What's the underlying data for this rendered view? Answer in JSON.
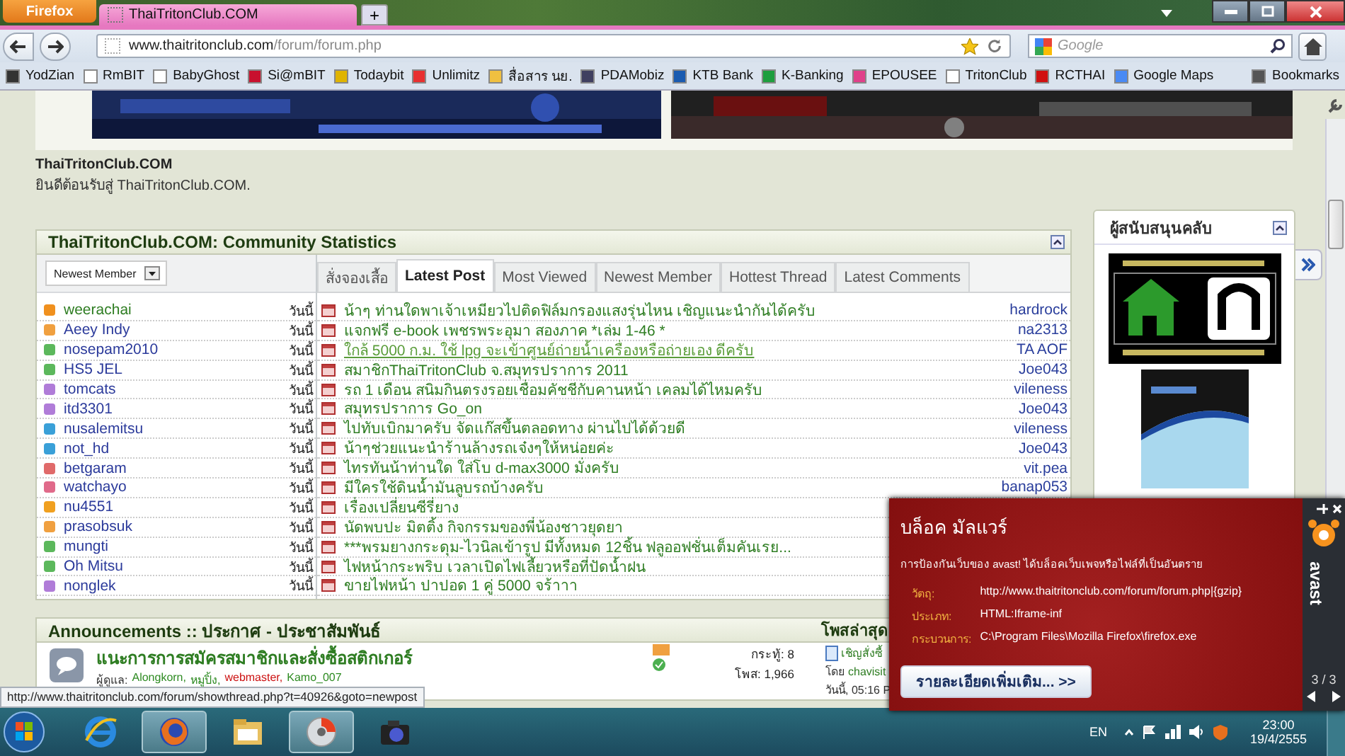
{
  "browser": {
    "app_button": "Firefox",
    "tabs": [
      {
        "title": "ThaiTritonClub.COM",
        "selected": true
      }
    ],
    "new_tab": "+",
    "url_host": "www.thaitritonclub.com",
    "url_path": "/forum/forum.php",
    "search_placeholder": "Google"
  },
  "bookmarks": [
    {
      "label": "YodZian",
      "color": "#333333"
    },
    {
      "label": "RmBIT",
      "color": "#ffffff"
    },
    {
      "label": "BabyGhost",
      "color": "#ffffff"
    },
    {
      "label": "Si@mBIT",
      "color": "#c8102e"
    },
    {
      "label": "Todaybit",
      "color": "#e0b400"
    },
    {
      "label": "Unlimitz",
      "color": "#e83030"
    },
    {
      "label": "สื่อสาร นย.",
      "color": "#f0c040"
    },
    {
      "label": "PDAMobiz",
      "color": "#404060"
    },
    {
      "label": "KTB Bank",
      "color": "#1a5bb0"
    },
    {
      "label": "K-Banking",
      "color": "#1e9e3e"
    },
    {
      "label": "EPOUSEE",
      "color": "#e0408a"
    },
    {
      "label": "TritonClub",
      "color": "#ffffff"
    },
    {
      "label": "RCTHAI",
      "color": "#d01010"
    },
    {
      "label": "Google Maps",
      "color": "#4a8af4"
    }
  ],
  "bookmarks_menu": "Bookmarks",
  "site": {
    "title": "ThaiTritonClub.COM",
    "welcome": "ยินดีต้อนรับสู่ ThaiTritonClub.COM."
  },
  "stats": {
    "title": "ThaiTritonClub.COM: Community Statistics",
    "dropdown": "Newest Member",
    "members": [
      {
        "name": "weerachai",
        "date": "วันนี้",
        "color": "#f0901e",
        "visited": true
      },
      {
        "name": "Aeey Indy",
        "date": "วันนี้",
        "color": "#f0a040",
        "visited": false
      },
      {
        "name": "nosepam2010",
        "date": "วันนี้",
        "color": "#5cb85c",
        "visited": false
      },
      {
        "name": "HS5 JEL",
        "date": "วันนี้",
        "color": "#5cb85c",
        "visited": false
      },
      {
        "name": "tomcats",
        "date": "วันนี้",
        "color": "#b07cd8",
        "visited": false
      },
      {
        "name": "itd3301",
        "date": "วันนี้",
        "color": "#b07cd8",
        "visited": false
      },
      {
        "name": "nusalemitsu",
        "date": "วันนี้",
        "color": "#3aa0d8",
        "visited": false
      },
      {
        "name": "not_hd",
        "date": "วันนี้",
        "color": "#3aa0d8",
        "visited": false
      },
      {
        "name": "betgaram",
        "date": "วันนี้",
        "color": "#e06a6a",
        "visited": false
      },
      {
        "name": "watchayo",
        "date": "วันนี้",
        "color": "#e06a8a",
        "visited": false
      },
      {
        "name": "nu4551",
        "date": "วันนี้",
        "color": "#f0a020",
        "visited": false
      },
      {
        "name": "prasobsuk",
        "date": "วันนี้",
        "color": "#f0a040",
        "visited": false
      },
      {
        "name": "mungti",
        "date": "วันนี้",
        "color": "#5cb85c",
        "visited": false
      },
      {
        "name": "Oh Mitsu",
        "date": "วันนี้",
        "color": "#5cb85c",
        "visited": false
      },
      {
        "name": "nonglek",
        "date": "วันนี้",
        "color": "#b07cd8",
        "visited": false
      }
    ],
    "tabs": [
      {
        "label": "สั่งจองเสื้อ",
        "selected": false
      },
      {
        "label": "Latest Post",
        "selected": true
      },
      {
        "label": "Most Viewed",
        "selected": false
      },
      {
        "label": "Newest Member",
        "selected": false
      },
      {
        "label": "Hottest Thread",
        "selected": false
      },
      {
        "label": "Latest Comments",
        "selected": false
      }
    ],
    "posts": [
      {
        "title": "น้าๆ ท่านใดพาเจ้าเหมียวไปติดฟิล์มกรองแสงรุ่นไหน เชิญแนะนำกันได้ครับ",
        "author": "hardrock",
        "hovered": false
      },
      {
        "title": "แจกฟรี e-book เพชรพระอุมา สองภาค *เล่ม 1-46 *",
        "author": "na2313",
        "hovered": false
      },
      {
        "title": "ใกล้ 5000 ก.ม. ใช้ lpg จะเข้าศูนย์ถ่ายน้ำเครื่องหรือถ่ายเอง ดีครับ",
        "author": "TA AOF",
        "hovered": true
      },
      {
        "title": "สมาชิกThaiTritonClub จ.สมุทรปราการ 2011",
        "author": "Joe043",
        "hovered": false
      },
      {
        "title": "รถ 1 เดือน สนิมกินตรงรอยเชื่อมคัชชีกับคานหน้า เคลมได้ไหมครับ",
        "author": "vileness",
        "hovered": false
      },
      {
        "title": "สมุทรปราการ Go_on",
        "author": "Joe043",
        "hovered": false
      },
      {
        "title": "ไปทับเบิกมาครับ จัดแก๊สขึ้นตลอดทาง ผ่านไปได้ด้วยดี",
        "author": "vileness",
        "hovered": false
      },
      {
        "title": "น้าๆช่วยแนะนำร้านล้างรถเจ๋งๆให้หน่อยค่ะ",
        "author": "Joe043",
        "hovered": false
      },
      {
        "title": "ไทรทันน้าท่านใด ใส่โบ d-max3000 มั่งครับ",
        "author": "vit.pea",
        "hovered": false
      },
      {
        "title": "มีใครใช้ดินน้ำมันลูบรถบ้างครับ",
        "author": "banap053",
        "hovered": false
      },
      {
        "title": "เรื่องเปลี่ยนซีรี่ยาง",
        "hovered": false
      },
      {
        "title": "นัดพบปะ มิตติ้ง กิจกรรมของพี่น้องชาวยุดยา",
        "hovered": false
      },
      {
        "title": "***พรมยางกระดุม-ไวนิลเข้ารูป มีทั้งหมด 12ชิ้น ฟลูออฟชั่นเต็มคันเรย...",
        "hovered": false
      },
      {
        "title": "ไฟหน้ากระพริบ เวลาเปิดไฟเลี้ยวหรือที่ปัดน้ำฝน",
        "hovered": false
      },
      {
        "title": "ขายไฟหน้า ปาปอด 1 คู่ 5000 จร้าาา",
        "hovered": false
      }
    ]
  },
  "sidebar": {
    "title": "ผู้สนับสนุนคลับ"
  },
  "announcements": {
    "title": "Announcements :: ประกาศ - ประชาสัมพันธ์",
    "latest_header": "โพสล่าสุด",
    "forum": {
      "title": "แนะการการสมัครสมาชิกและสั่งซื้อสติกเกอร์",
      "moderators_label": "ผู้ดูแล:",
      "moderators": [
        {
          "name": "Alongkorn,",
          "color": "#2e8b22"
        },
        {
          "name": "หมูปิ้ง,",
          "color": "#2e8b22"
        },
        {
          "name": "webmaster,",
          "color": "#cc1111"
        },
        {
          "name": "Kamo_007",
          "color": "#2e8b22"
        }
      ],
      "threads": "กระทู้: 8",
      "posts": "โพส: 1,966",
      "last_post": "เชิญสั่งซื้",
      "by_label": "โดย",
      "by": "chavisit",
      "time": "วันนี้, 05:16 P"
    }
  },
  "status_url": "http://www.thaitritonclub.com/forum/showthread.php?t=40926&goto=newpost",
  "popup": {
    "title": "บล็อค มัลแวร์",
    "message": "การป้องกันเว็บของ avast! ได้บล็อคเว็บเพจหรือไฟล์ที่เป็นอันตราย",
    "fields": [
      {
        "label": "วัตถุ:",
        "value": "http://www.thaitritonclub.com/forum/forum.php|{gzip}"
      },
      {
        "label": "ประเภท:",
        "value": "HTML:Iframe-inf"
      },
      {
        "label": "กระบวนการ:",
        "value": "C:\\Program Files\\Mozilla Firefox\\firefox.exe"
      }
    ],
    "button": "รายละเอียดเพิ่มเติม... >>",
    "brand": "avast",
    "pager": "3 / 3"
  },
  "taskbar": {
    "apps": [
      {
        "kind": "ie",
        "active": false
      },
      {
        "kind": "firefox",
        "active": true
      },
      {
        "kind": "folder",
        "active": false
      },
      {
        "kind": "disc",
        "active": true
      },
      {
        "kind": "camera",
        "active": false
      }
    ],
    "language": "EN",
    "time": "23:00",
    "date": "19/4/2555"
  }
}
